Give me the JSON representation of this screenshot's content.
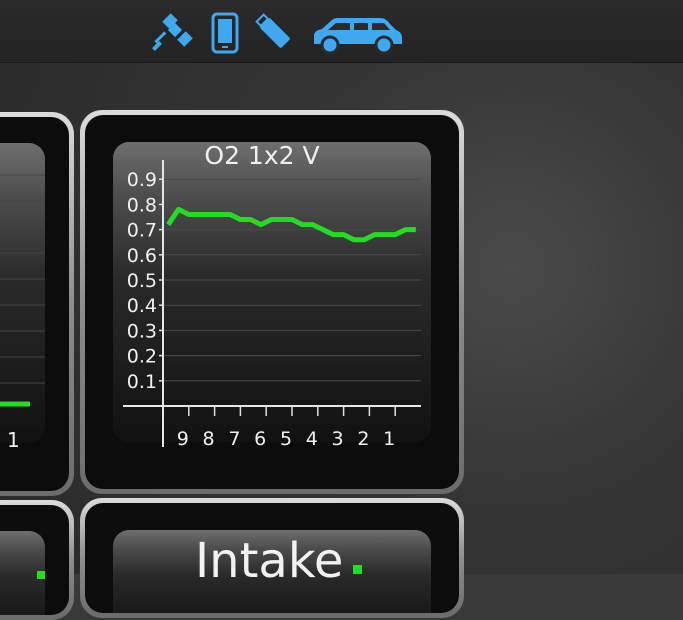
{
  "status_bar": {
    "icons": [
      "satellite-icon",
      "phone-icon",
      "usb-stick-icon",
      "car-icon"
    ],
    "icon_color": "#3ea8f0"
  },
  "left_tile": {
    "line_color": "#22dd22",
    "partial_tick": "1"
  },
  "o2_tile": {
    "title": "O2 1x2  V",
    "line_color": "#22dd22",
    "chart_data": {
      "type": "line",
      "title": "O2 1x2  V",
      "y_ticks": [
        "0.1",
        "0.2",
        "0.3",
        "0.4",
        "0.5",
        "0.6",
        "0.7",
        "0.8",
        "0.9"
      ],
      "x_ticks": [
        "9",
        "8",
        "7",
        "6",
        "5",
        "4",
        "3",
        "2",
        "1"
      ],
      "ylim": [
        0,
        0.95
      ],
      "xlim": [
        10,
        0
      ],
      "grid": true,
      "series": [
        {
          "x": [
            9.8,
            9.4,
            9.0,
            8.6,
            8.2,
            7.8,
            7.4,
            7.0,
            6.6,
            6.2,
            5.8,
            5.4,
            5.0,
            4.6,
            4.2,
            3.8,
            3.4,
            3.0,
            2.6,
            2.2,
            1.8,
            1.4,
            1.0,
            0.6,
            0.2
          ],
          "values": [
            0.72,
            0.78,
            0.76,
            0.76,
            0.76,
            0.76,
            0.76,
            0.74,
            0.74,
            0.72,
            0.74,
            0.74,
            0.74,
            0.72,
            0.72,
            0.7,
            0.68,
            0.68,
            0.66,
            0.66,
            0.68,
            0.68,
            0.68,
            0.7,
            0.7
          ]
        }
      ]
    }
  },
  "bottom_tile": {
    "label": "Intake"
  }
}
